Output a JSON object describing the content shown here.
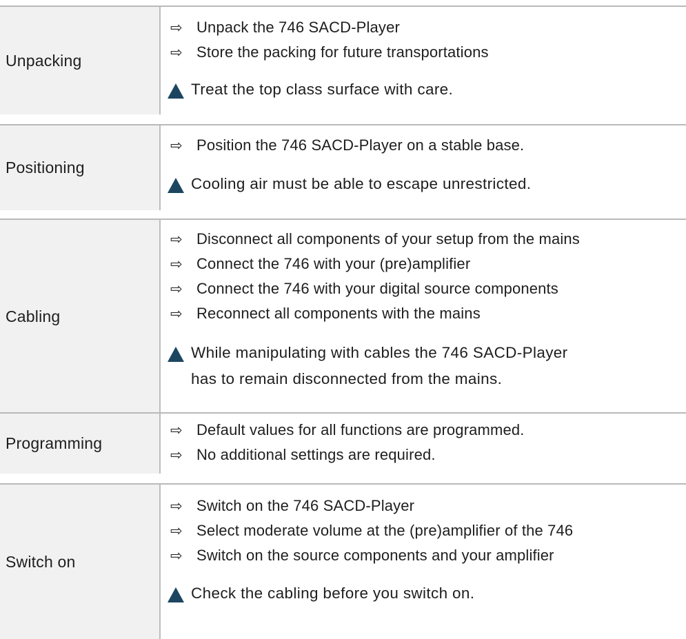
{
  "sections": [
    {
      "label": "Unpacking",
      "items": [
        "Unpack the 746 SACD-Player",
        "Store the packing for future transportations"
      ],
      "warning": "Treat the top class surface with care."
    },
    {
      "label": "Positioning",
      "items": [
        "Position the 746 SACD-Player on a stable base."
      ],
      "warning": "Cooling air must be able to escape unrestricted."
    },
    {
      "label": "Cabling",
      "items": [
        "Disconnect all components of your setup from the mains",
        "Connect the 746 with your (pre)amplifier",
        "Connect the 746 with your digital source components",
        "Reconnect all components with the mains"
      ],
      "warning_line1": "While manipulating with cables the 746 SACD-Player",
      "warning_line2": "has to remain disconnected from the mains."
    },
    {
      "label": "Programming",
      "items": [
        "Default values for all functions are programmed.",
        "No additional settings are required."
      ]
    },
    {
      "label": "Switch on",
      "items": [
        "Switch on the 746 SACD-Player",
        "Select moderate volume at the (pre)amplifier of the 746",
        "Switch on the source components and your amplifier"
      ],
      "warning": "Check the cabling before you switch on."
    }
  ],
  "icons": {
    "bullet": "arrow-right-icon",
    "warning": "warning-triangle-icon"
  },
  "colors": {
    "warning_icon": "#1c4660",
    "label_background": "#f1f1f1",
    "rule": "#b9b9b9"
  }
}
